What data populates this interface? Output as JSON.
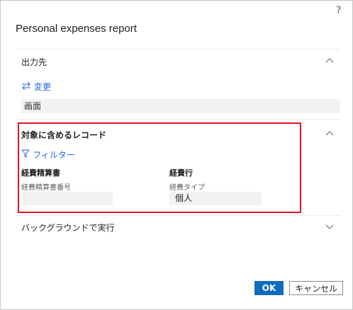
{
  "dialog": {
    "title": "Personal expenses report",
    "help_label": "?"
  },
  "section_destination": {
    "title": "出力先",
    "change_link": "変更",
    "value": "画面"
  },
  "section_records": {
    "title": "対象に含めるレコード",
    "filter_link": "フィルター",
    "col1": {
      "heading": "経費精算書",
      "field_label": "経費精算書番号",
      "field_value": ""
    },
    "col2": {
      "heading": "経費行",
      "field_label": "経費タイプ",
      "field_value": "個人"
    }
  },
  "section_background": {
    "title": "バックグラウンドで実行"
  },
  "buttons": {
    "ok": "OK",
    "cancel": "キャンセル"
  },
  "colors": {
    "accent": "#0f6cbd",
    "link": "#2266e3",
    "highlight": "#e81123"
  }
}
